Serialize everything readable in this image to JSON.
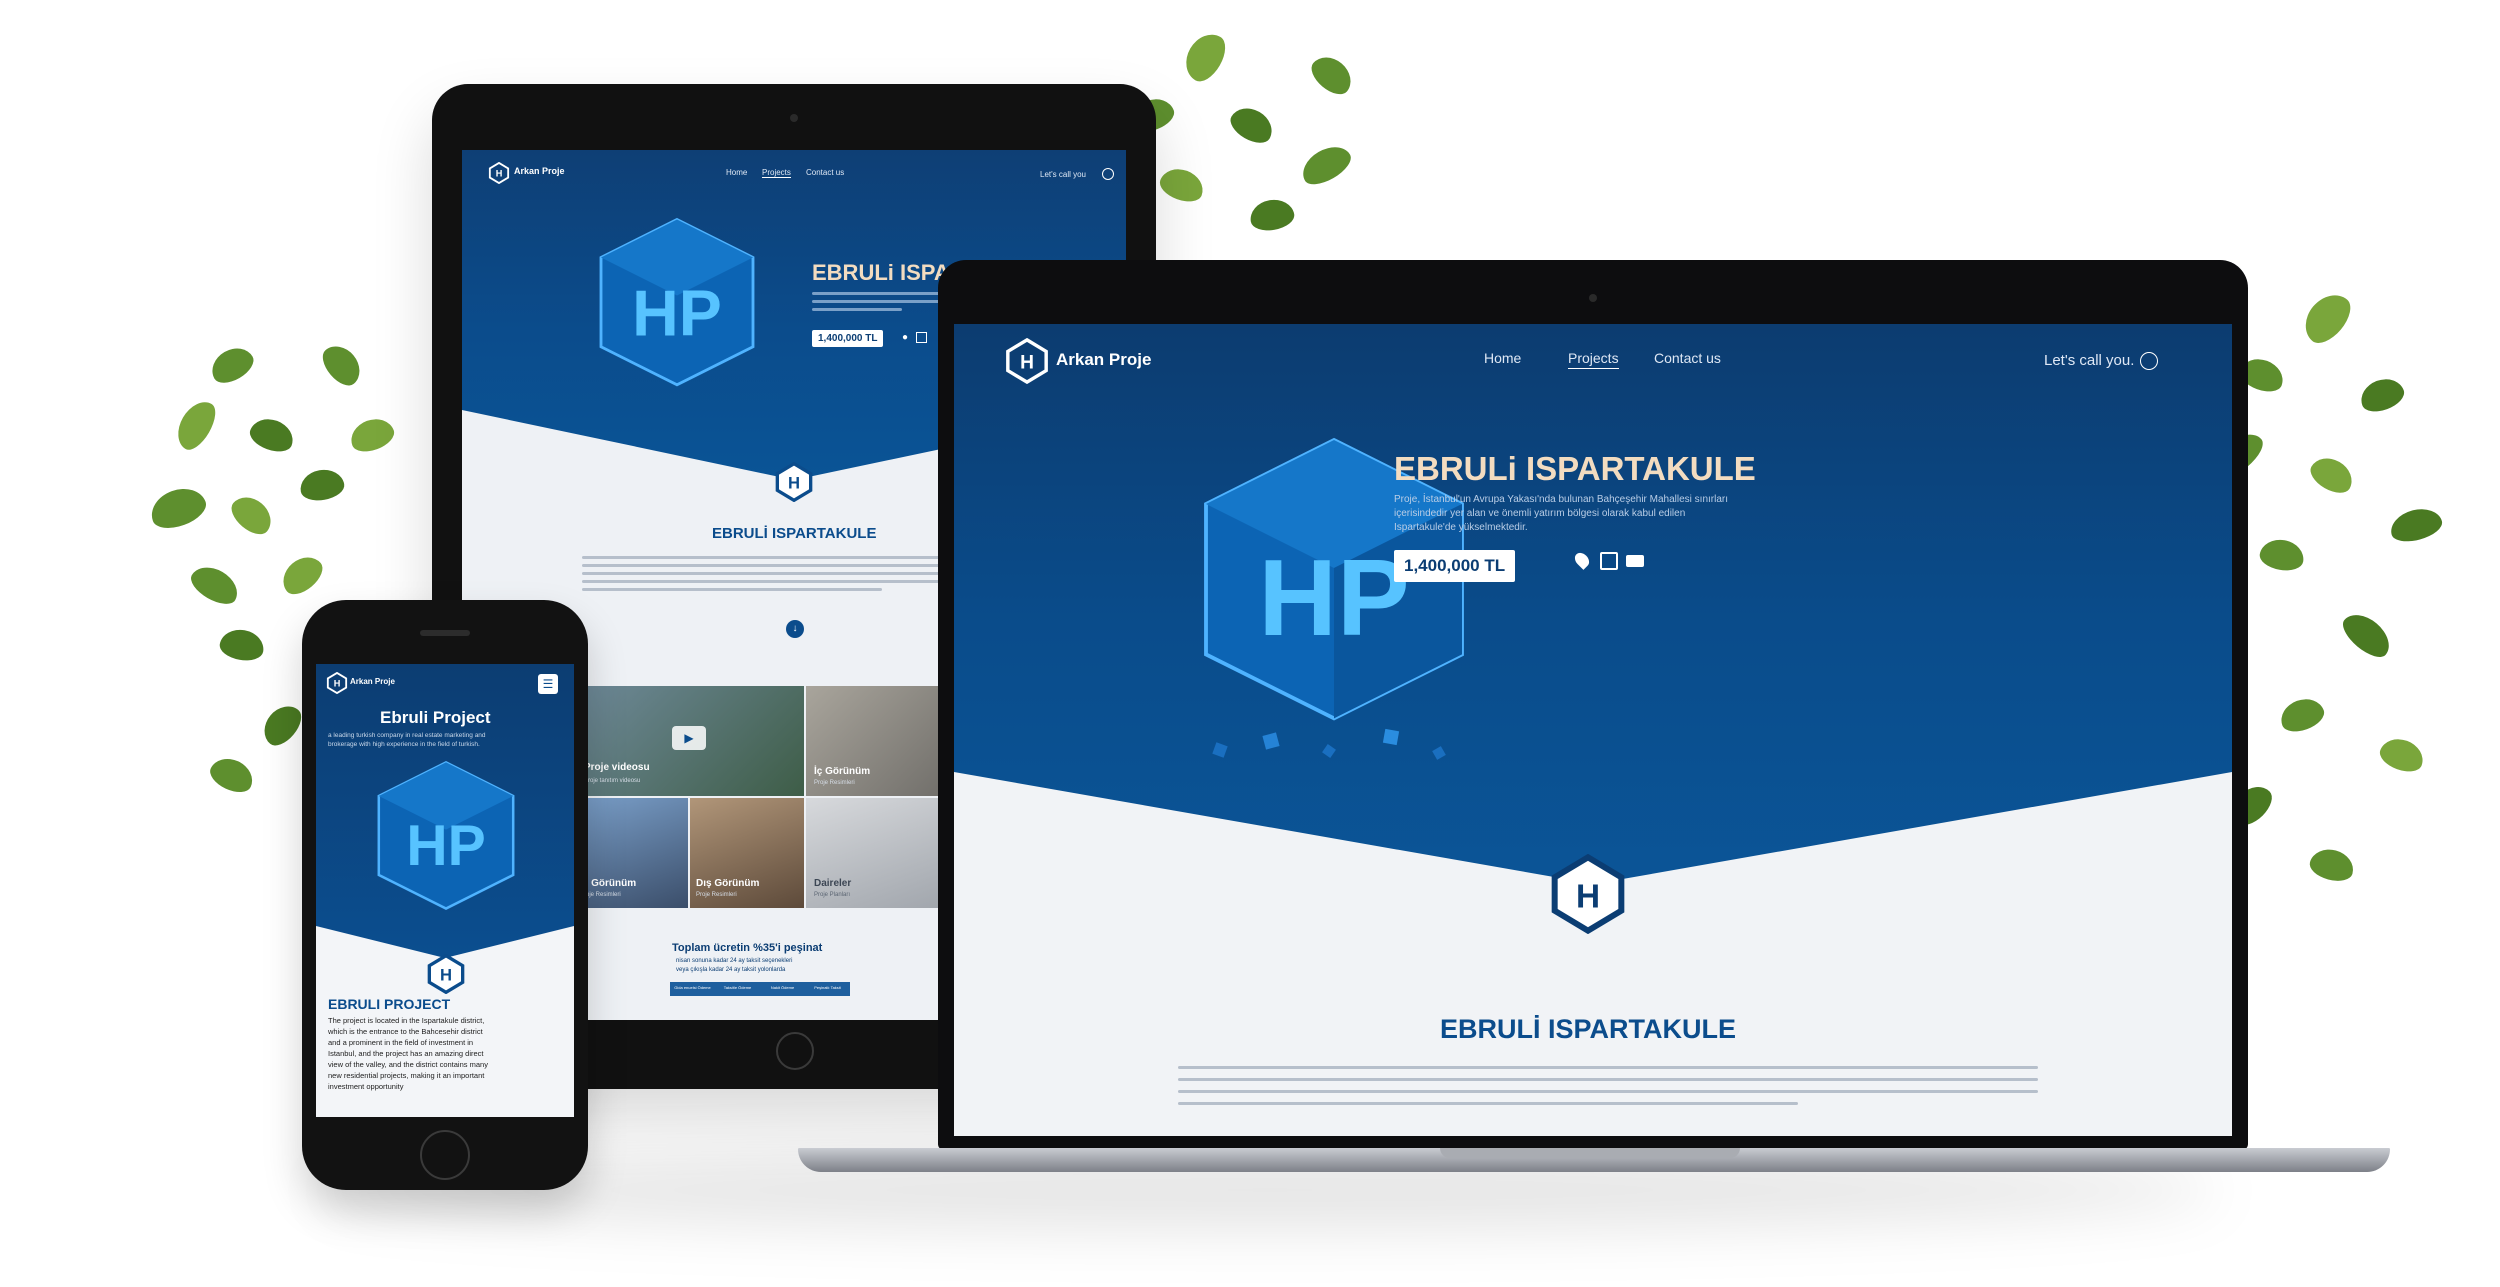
{
  "brand": {
    "name": "Arkan Proje"
  },
  "nav": {
    "home": "Home",
    "projects": "Projects",
    "contact": "Contact us",
    "call": "Let's call you."
  },
  "tablet_nav": {
    "home": "Home",
    "projects": "Projects",
    "contact": "Contact us",
    "call": "Let's call you"
  },
  "hero": {
    "title": "EBRULi ISPARTAKULE",
    "tablet_title": "EBRULi ISPART",
    "description_l1": "Proje, İstanbul'un Avrupa Yakası'nda bulunan Bahçeşehir Mahallesi sınırları",
    "description_l2": "içerisindedir yer alan ve önemli yatırım bölgesi olarak kabul edilen",
    "description_l3": "Ispartakule'de yükselmektedir.",
    "price": "1,400,000 TL"
  },
  "section": {
    "title": "EBRULİ ISPARTAKULE",
    "tablet_title": "EBRULİ ISPARTAKULE"
  },
  "gallery": {
    "tiles": [
      {
        "caption": "Proje videosu",
        "sub": "Proje tanıtım videosu"
      },
      {
        "caption": "İç Görünüm",
        "sub": "Proje Resimleri"
      },
      {
        "caption": "İç Görünüm",
        "sub": "Proje Resimleri"
      },
      {
        "caption": "Dış Görünüm",
        "sub": "Proje Resimleri"
      },
      {
        "caption": "Daireler",
        "sub": "Proje Planları"
      }
    ]
  },
  "payment": {
    "title": "Toplam ücretin %35'i peşinat",
    "line1": "nisan sonuna kadar 24 ay taksit seçenekleri",
    "line2": "veya çıkışla kadar 24 ay taksit yolonlarda",
    "tabs": [
      "Gida enuelsi Ödeme",
      "Taksitle Ödeme",
      "Nakit Ödeme",
      "Peşinatlı Taksit"
    ]
  },
  "phone": {
    "hero_title": "Ebruli Project",
    "hero_sub_l1": "a leading turkish company in real estate marketing and",
    "hero_sub_l2": "brokerage with high experience in the field of turkish.",
    "section_title": "EBRULI PROJECT",
    "body_l1": "The project is located in the Ispartakule district,",
    "body_l2": "which is the entrance to the Bahcesehir district",
    "body_l3": "and a prominent in the field of investment in",
    "body_l4": "Istanbul, and the project has an amazing direct",
    "body_l5": "view of the valley, and the district contains many",
    "body_l6": "new residential projects, making it an important",
    "body_l7": "investment opportunity"
  },
  "colors": {
    "primary": "#0b4c8c",
    "dark": "#0c3c70",
    "accent_gold": "#f3dcc0",
    "device": "#111111"
  },
  "icons": [
    "location-icon",
    "calendar-icon",
    "video-icon",
    "globe-icon",
    "play-icon",
    "arrow-down-icon",
    "menu-icon"
  ]
}
